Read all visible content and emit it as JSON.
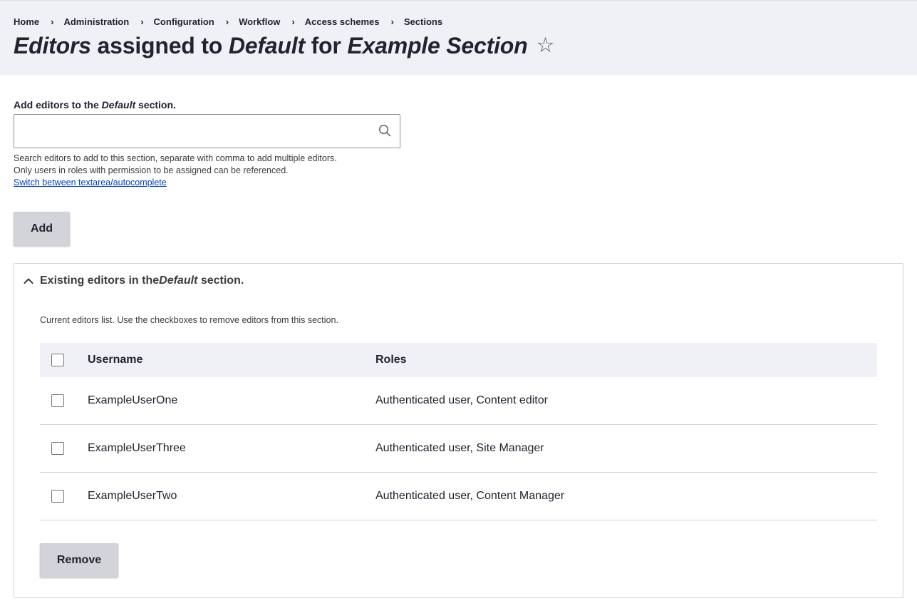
{
  "breadcrumb": [
    {
      "label": "Home"
    },
    {
      "label": "Administration"
    },
    {
      "label": "Configuration"
    },
    {
      "label": "Workflow"
    },
    {
      "label": "Access schemes"
    },
    {
      "label": "Sections"
    }
  ],
  "title": {
    "part1": "Editors",
    "part2": " assigned to ",
    "part3": "Default",
    "part4": " for ",
    "part5": "Example Section",
    "star": "☆"
  },
  "add_field": {
    "label_prefix": "Add editors to the ",
    "label_em": "Default",
    "label_suffix": " section.",
    "value": "",
    "placeholder": "",
    "desc_line1": "Search editors to add to this section, separate with comma to add multiple editors.",
    "desc_line2": "Only users in roles with permission to be assigned can be referenced.",
    "switch_link": "Switch between textarea/autocomplete",
    "add_button": "Add"
  },
  "existing": {
    "summary_prefix": "Existing editors in the ",
    "summary_em": "Default",
    "summary_suffix": " section.",
    "description": "Current editors list. Use the checkboxes to remove editors from this section.",
    "columns": {
      "username": "Username",
      "roles": "Roles"
    },
    "rows": [
      {
        "username": "ExampleUserOne",
        "roles": "Authenticated user, Content editor"
      },
      {
        "username": "ExampleUserThree",
        "roles": "Authenticated user, Site Manager"
      },
      {
        "username": "ExampleUserTwo",
        "roles": "Authenticated user, Content Manager"
      }
    ],
    "remove_button": "Remove"
  },
  "icons": {
    "search": "search-icon",
    "chevron": "chevron-up-icon",
    "star": "star-icon"
  }
}
